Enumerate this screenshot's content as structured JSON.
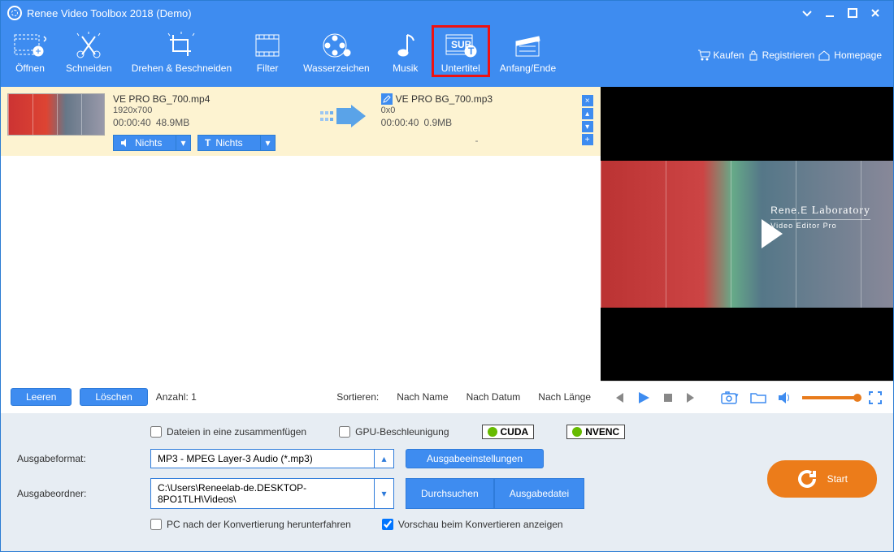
{
  "window": {
    "title": "Renee Video Toolbox 2018 (Demo)"
  },
  "toolbar": {
    "open": "Öffnen",
    "cut": "Schneiden",
    "rotate": "Drehen & Beschneiden",
    "filter": "Filter",
    "watermark": "Wasserzeichen",
    "music": "Musik",
    "subtitle": "Untertitel",
    "startend": "Anfang/Ende"
  },
  "rlinks": {
    "buy": "Kaufen",
    "register": "Registrieren",
    "home": "Homepage"
  },
  "file": {
    "src": {
      "name": "VE PRO BG_700.mp4",
      "dims": "1920x700",
      "duration": "00:00:40",
      "size": "48.9MB"
    },
    "dst": {
      "name": "VE PRO BG_700.mp3",
      "dims": "0x0",
      "duration": "00:00:40",
      "size": "0.9MB"
    },
    "dd_audio": "Nichts",
    "dd_sub": "Nichts",
    "dash": "-"
  },
  "preview": {
    "brand": "Rene.E",
    "sub": "Video Editor Pro"
  },
  "sort": {
    "clear": "Leeren",
    "delete": "Löschen",
    "count_label": "Anzahl: 1",
    "sortby": "Sortieren:",
    "name": "Nach Name",
    "date": "Nach Datum",
    "length": "Nach Länge"
  },
  "settings": {
    "merge": "Dateien in eine zusammenfügen",
    "gpu": "GPU-Beschleunigung",
    "cuda": "CUDA",
    "nvenc": "NVENC",
    "outfmt_label": "Ausgabeformat:",
    "outfmt_value": "MP3 - MPEG Layer-3 Audio (*.mp3)",
    "outset": "Ausgabeeinstellungen",
    "outdir_label": "Ausgabeordner:",
    "outdir_value": "C:\\Users\\Reneelab-de.DESKTOP-8PO1TLH\\Videos\\",
    "browse": "Durchsuchen",
    "outfile": "Ausgabedatei",
    "shutdown": "PC nach der Konvertierung herunterfahren",
    "preview": "Vorschau beim Konvertieren anzeigen",
    "start": "Start"
  }
}
